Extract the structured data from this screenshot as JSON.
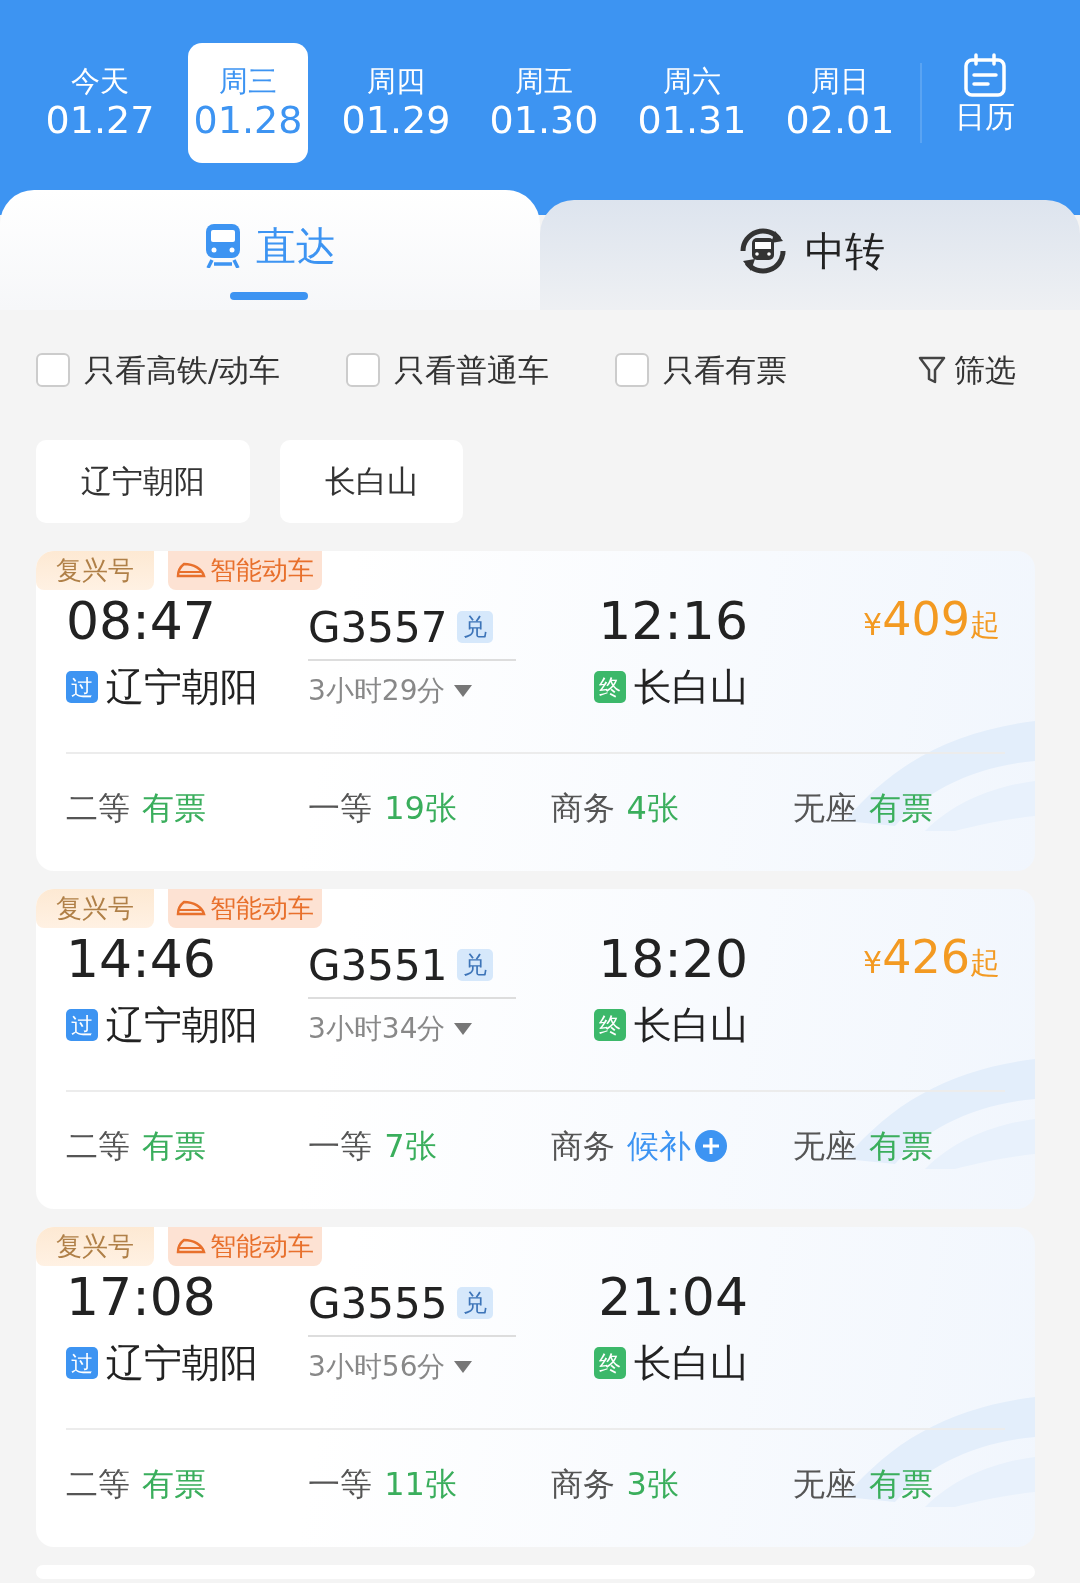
{
  "dates": [
    {
      "weekday": "今天",
      "date": "01.27",
      "selected": false
    },
    {
      "weekday": "周三",
      "date": "01.28",
      "selected": true
    },
    {
      "weekday": "周四",
      "date": "01.29",
      "selected": false
    },
    {
      "weekday": "周五",
      "date": "01.30",
      "selected": false
    },
    {
      "weekday": "周六",
      "date": "01.31",
      "selected": false
    },
    {
      "weekday": "周日",
      "date": "02.01",
      "selected": false
    }
  ],
  "calendar_label": "日历",
  "tabs": [
    {
      "label": "直达",
      "kind": "direct",
      "selected": true
    },
    {
      "label": "中转",
      "kind": "transfer",
      "selected": false
    }
  ],
  "filters": [
    {
      "label": "只看高铁/动车",
      "checked": false
    },
    {
      "label": "只看普通车",
      "checked": false
    },
    {
      "label": "只看有票",
      "checked": false
    }
  ],
  "filter_button": "筛选",
  "stations": [
    "辽宁朝阳",
    "长白山"
  ],
  "trains": [
    {
      "tags": [
        {
          "label": "复兴号",
          "kind": "plain"
        },
        {
          "label": "智能动车",
          "kind": "smart"
        }
      ],
      "depart_time": "08:47",
      "train_no": "G3557",
      "badge": "兑",
      "arrive_time": "12:16",
      "price": {
        "symbol": "¥",
        "amount": "409",
        "suffix": "起"
      },
      "from_mark": "过",
      "from": "辽宁朝阳",
      "duration": "3小时29分",
      "to_mark": "终",
      "to": "长白山",
      "seats": [
        {
          "class": "二等",
          "status": "有票",
          "kind": "available"
        },
        {
          "class": "一等",
          "status": "19张",
          "kind": "available"
        },
        {
          "class": "商务",
          "status": "4张",
          "kind": "available"
        },
        {
          "class": "无座",
          "status": "有票",
          "kind": "available"
        }
      ]
    },
    {
      "tags": [
        {
          "label": "复兴号",
          "kind": "plain"
        },
        {
          "label": "智能动车",
          "kind": "smart"
        }
      ],
      "depart_time": "14:46",
      "train_no": "G3551",
      "badge": "兑",
      "arrive_time": "18:20",
      "price": {
        "symbol": "¥",
        "amount": "426",
        "suffix": "起"
      },
      "from_mark": "过",
      "from": "辽宁朝阳",
      "duration": "3小时34分",
      "to_mark": "终",
      "to": "长白山",
      "seats": [
        {
          "class": "二等",
          "status": "有票",
          "kind": "available"
        },
        {
          "class": "一等",
          "status": "7张",
          "kind": "available"
        },
        {
          "class": "商务",
          "status": "候补",
          "kind": "waitlist"
        },
        {
          "class": "无座",
          "status": "有票",
          "kind": "available"
        }
      ]
    },
    {
      "tags": [
        {
          "label": "复兴号",
          "kind": "plain"
        },
        {
          "label": "智能动车",
          "kind": "smart"
        }
      ],
      "depart_time": "17:08",
      "train_no": "G3555",
      "badge": "兑",
      "arrive_time": "21:04",
      "from_mark": "过",
      "from": "辽宁朝阳",
      "duration": "3小时56分",
      "to_mark": "终",
      "to": "长白山",
      "seats": [
        {
          "class": "二等",
          "status": "有票",
          "kind": "available"
        },
        {
          "class": "一等",
          "status": "11张",
          "kind": "available"
        },
        {
          "class": "商务",
          "status": "3张",
          "kind": "available"
        },
        {
          "class": "无座",
          "status": "有票",
          "kind": "available"
        }
      ]
    }
  ]
}
